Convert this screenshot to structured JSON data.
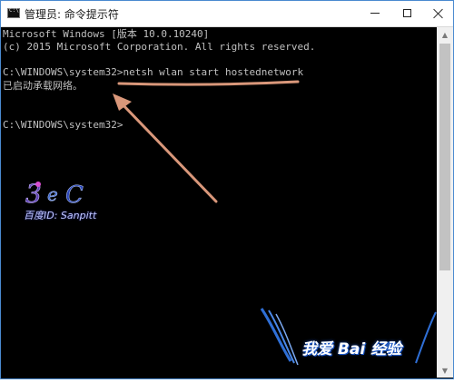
{
  "window": {
    "title": "管理员: 命令提示符",
    "icon": "cmd-icon",
    "controls": {
      "minimize_icon": "minimize-icon",
      "maximize_icon": "maximize-icon",
      "close_icon": "close-icon"
    }
  },
  "console": {
    "lines": [
      "Microsoft Windows [版本 10.0.10240]",
      "(c) 2015 Microsoft Corporation. All rights reserved.",
      "",
      "C:\\WINDOWS\\system32>netsh wlan start hostednetwork",
      "已启动承载网络。",
      "",
      "",
      "C:\\WINDOWS\\system32>"
    ]
  },
  "watermarks": {
    "left_text": "百度ID: Sanpitt",
    "right_text": "我爱 Bai 经验"
  },
  "colors": {
    "console_bg": "#000000",
    "console_text": "#c0c0c0",
    "annotation": "#d9977a"
  }
}
